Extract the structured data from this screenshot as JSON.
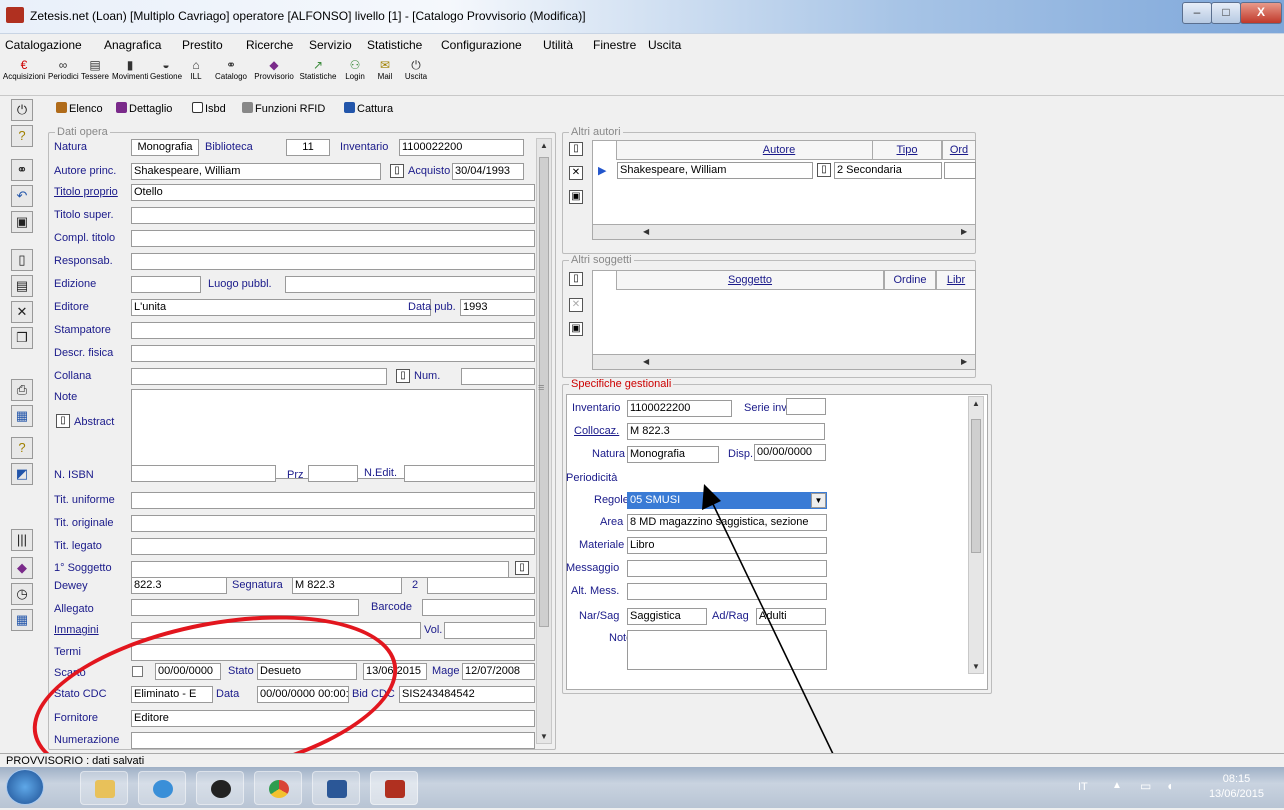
{
  "window": {
    "title": "Zetesis.net (Loan) [Multiplo Cavriago] operatore [ALFONSO] livello [1] - [Catalogo Provvisorio (Modifica)]",
    "min": "–",
    "max": "□",
    "close": "X"
  },
  "menu": [
    "Catalogazione",
    "Anagrafica",
    "Prestito",
    "Ricerche",
    "Servizio",
    "Statistiche",
    "Configurazione",
    "Utilità",
    "Finestre",
    "Uscita"
  ],
  "toolbar": [
    "Acquisizioni",
    "Periodici",
    "Tessere",
    "Movimenti",
    "Gestione",
    "ILL",
    "Catalogo",
    "Provvisorio",
    "Statistiche",
    "Login",
    "Mail",
    "Uscita"
  ],
  "tabs": [
    "Elenco",
    "Dettaglio",
    "Isbd",
    "Funzioni RFID",
    "Cattura"
  ],
  "dati_opera": {
    "group": "Dati opera",
    "natura_lbl": "Natura",
    "natura": "Monografia",
    "biblioteca_lbl": "Biblioteca",
    "biblioteca": "11",
    "inventario_lbl": "Inventario",
    "inventario": "1100022200",
    "autore_lbl": "Autore princ.",
    "autore": "Shakespeare, William",
    "acquisto_lbl": "Acquisto",
    "acquisto": "30/04/1993",
    "titolo_lbl": "Titolo proprio",
    "titolo": "Otello",
    "titolo_super_lbl": "Titolo super.",
    "compl_lbl": "Compl. titolo",
    "responsab_lbl": "Responsab.",
    "edizione_lbl": "Edizione",
    "luogo_lbl": "Luogo pubbl.",
    "editore_lbl": "Editore",
    "editore": "L'unita",
    "data_pub_lbl": "Data pub.",
    "data_pub": "1993",
    "stampatore_lbl": "Stampatore",
    "descr_lbl": "Descr. fisica",
    "collana_lbl": "Collana",
    "num_lbl": "Num.",
    "note_lbl": "Note",
    "abstract_lbl": "Abstract",
    "isbn_lbl": "N. ISBN",
    "prz_lbl": "Prz",
    "nedit_lbl": "N.Edit.",
    "tit_uniforme_lbl": "Tit. uniforme",
    "tit_originale_lbl": "Tit. originale",
    "tit_legato_lbl": "Tit. legato",
    "soggetto_lbl": "1° Soggetto",
    "dewey_lbl": "Dewey",
    "dewey": "822.3",
    "segnatura_lbl": "Segnatura",
    "segnatura": "M 822.3",
    "num2": "2",
    "allegato_lbl": "Allegato",
    "barcode_lbl": "Barcode",
    "immagini_lbl": "Immagini",
    "vol_lbl": "Vol.",
    "termi_lbl": "Termi",
    "scarto_lbl": "Scarto",
    "scarto_date": "00/00/0000",
    "stato_lbl": "Stato",
    "stato": "Desueto",
    "stato_date": "13/06/2015",
    "mage_lbl": "Mage",
    "mage": "12/07/2008",
    "stato_cdc_lbl": "Stato CDC",
    "stato_cdc": "Eliminato - E",
    "data_lbl": "Data",
    "data": "00/00/0000 00:00:0(",
    "bid_lbl": "Bid CDC",
    "bid": "SIS243484542",
    "fornitore_lbl": "Fornitore",
    "fornitore": "Editore",
    "numerazione_lbl": "Numerazione"
  },
  "altri_autori": {
    "group": "Altri autori",
    "col_autore": "Autore",
    "col_tipo": "Tipo responsabilità",
    "col_ord": "Ord",
    "row_autore": "Shakespeare, William",
    "row_tipo": "2 Secondaria"
  },
  "altri_soggetti": {
    "group": "Altri soggetti",
    "col_soggetto": "Soggetto",
    "col_ordine": "Ordine",
    "col_libr": "Libr"
  },
  "specifiche": {
    "group": "Specifiche gestionali",
    "inventario_lbl": "Inventario",
    "inventario": "1100022200",
    "serie_lbl": "Serie inv",
    "collocaz_lbl": "Collocaz.",
    "collocaz": "M 822.3",
    "natura_lbl": "Natura",
    "natura": "Monografia",
    "disp_lbl": "Disp.",
    "disp": "00/00/0000",
    "periodicita_lbl": "Periodicità",
    "regole_lbl": "Regole",
    "regole": "05 SMUSI",
    "area_lbl": "Area",
    "area": "8 MD magazzino saggistica, sezione",
    "materiale_lbl": "Materiale",
    "materiale": "Libro",
    "messaggio_lbl": "Messaggio",
    "alt_mess_lbl": "Alt. Mess.",
    "narsag_lbl": "Nar/Sag",
    "narsag": "Saggistica",
    "adrag_lbl": "Ad/Rag",
    "adrag": "Adulti",
    "note_lbl": "Note"
  },
  "status": "PROVVISORIO : dati salvati",
  "clock": {
    "time": "08:15",
    "date": "13/06/2015"
  },
  "tray": {
    "lang": "IT"
  },
  "colors": {
    "label": "#1a1a8a",
    "selection": "#3a7bd5",
    "annotation": "#e2161e"
  }
}
